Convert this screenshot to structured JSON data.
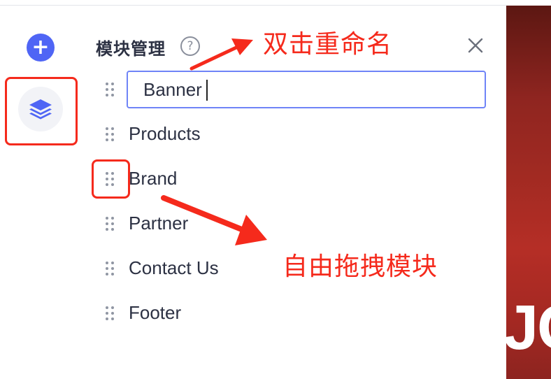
{
  "sidebar": {
    "add_label": "+",
    "add_icon": "plus-icon",
    "layers_icon": "layers-icon"
  },
  "panel": {
    "title": "模块管理",
    "help_glyph": "?",
    "rename_value": "Banner",
    "modules": [
      "Products",
      "Brand",
      "Partner",
      "Contact Us",
      "Footer"
    ]
  },
  "annotations": {
    "rename_hint": "双击重命名",
    "drag_hint": "自由拖拽模块"
  },
  "preview": {
    "visible_text": "JC"
  },
  "colors": {
    "accent": "#4f65f5",
    "annotation": "#f52a1c",
    "text": "#2c3143"
  }
}
